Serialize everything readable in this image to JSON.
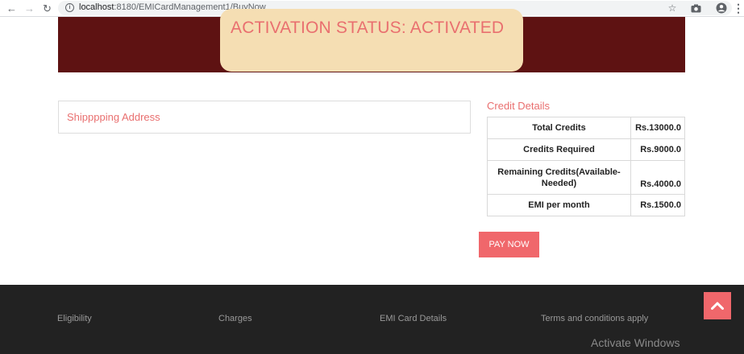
{
  "browser": {
    "url_host": "localhost",
    "url_path": ":8180/EMICardManagement1/BuyNow"
  },
  "banner": {
    "status_text": "ACTIVATION STATUS: ACTIVATED"
  },
  "shipping": {
    "label": "Shipppping Address"
  },
  "credit_details": {
    "title": "Credit Details",
    "rows": [
      {
        "label": "Total Credits",
        "value": "Rs.13000.0"
      },
      {
        "label": "Credits Required",
        "value": "Rs.9000.0"
      },
      {
        "label": "Remaining Credits(Available-Needed)",
        "value": "Rs.4000.0"
      },
      {
        "label": "EMI per month",
        "value": "Rs.1500.0"
      }
    ]
  },
  "pay_button": "PAY NOW",
  "footer": {
    "links": [
      "Eligibility",
      "Charges",
      "EMI Card Details",
      "Terms and conditions apply"
    ],
    "watermark": "Activate Windows"
  },
  "colors": {
    "accent": "#f0676b",
    "banner_bg": "#5e1212",
    "status_card_bg": "#f5deb3",
    "footer_bg": "#222222"
  }
}
